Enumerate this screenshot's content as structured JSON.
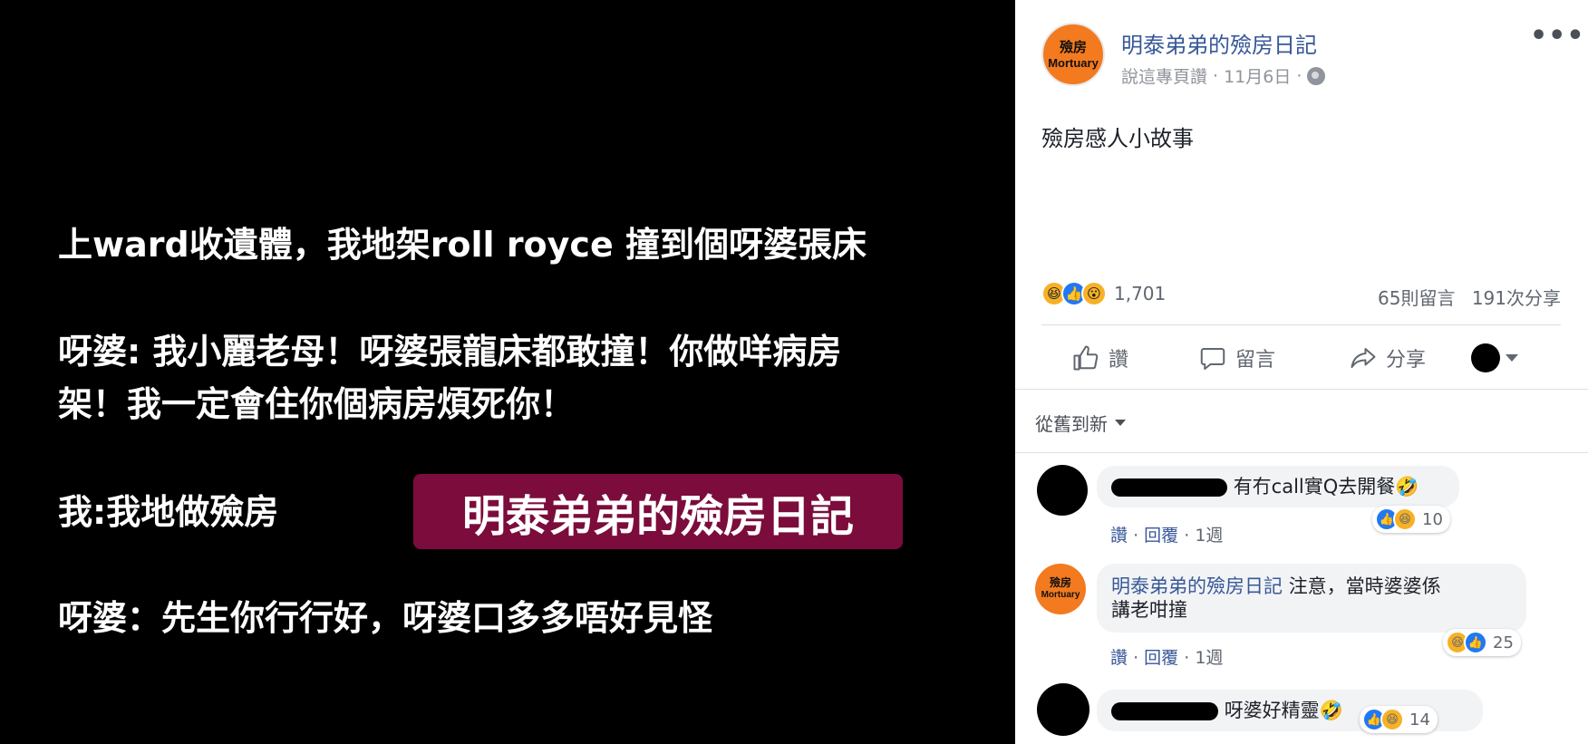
{
  "image": {
    "lines": [
      "上ward收遺體，我地架roll royce 撞到個呀婆張床",
      "呀婆: 我小麗老母！呀婆張龍床都敢撞！你做咩病房",
      "架！我一定會住你個病房煩死你！",
      "我:我地做殮房",
      "呀婆：先生你行行好，呀婆口多多唔好見怪"
    ],
    "watermark": "明泰弟弟的殮房日記"
  },
  "post": {
    "avatar_text_1": "殮房",
    "avatar_text_2": "Mortuary",
    "page_name": "明泰弟弟的殮房日記",
    "meta_prefix": "說這專頁讚",
    "date": "11月6日",
    "more_icon": "•••",
    "text": "殮房感人小故事",
    "reaction_count": "1,701",
    "comment_count": "65則留言",
    "share_count": "191次分享",
    "colors": {
      "link": "#385898",
      "accent_orange": "#f37a1f",
      "like_blue": "#2078f4",
      "watermark_bg": "#7c0c3c"
    }
  },
  "actions": {
    "like": "讚",
    "comment": "留言",
    "share": "分享"
  },
  "sort": {
    "label": "從舊到新"
  },
  "comments": [
    {
      "author_redacted": true,
      "text": "有冇call實Q去開餐🤣",
      "like": "讚",
      "reply": "回覆",
      "time": "1週",
      "reaction_count": "10"
    },
    {
      "author": "明泰弟弟的殮房日記",
      "text": "注意，當時婆婆係",
      "text2": "講老咁撞",
      "like": "讚",
      "reply": "回覆",
      "time": "1週",
      "reaction_count": "25"
    },
    {
      "author_redacted": true,
      "text": "呀婆好精靈🤣",
      "reaction_count": "14"
    }
  ]
}
